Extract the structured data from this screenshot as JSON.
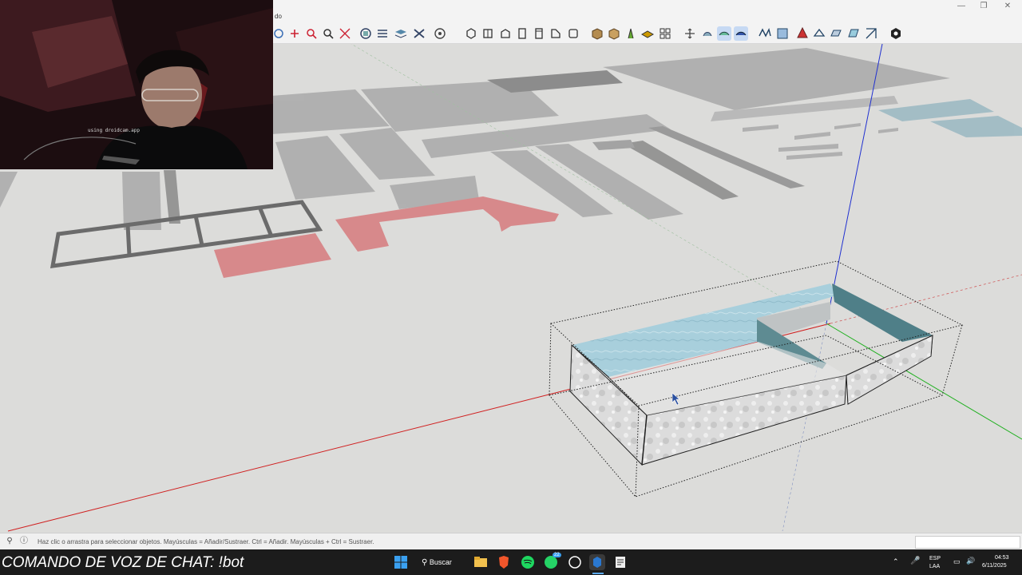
{
  "titlebar": {
    "menu_fragment": "do",
    "minimize_icon": "minimize-icon",
    "maximize_icon": "restore-icon",
    "close_icon": "close-icon"
  },
  "toolbar": {
    "icons": [
      "orbit-icon",
      "pan-icon",
      "zoom-icon",
      "zoom-extents-icon",
      "section-icon",
      "axes-icon",
      "layers-icon",
      "styles-icon",
      "camera-icon",
      "iso-view-icon",
      "top-view-icon",
      "front-view-icon",
      "right-view-icon",
      "back-view-icon",
      "left-view-icon",
      "bottom-view-icon",
      "xray-icon",
      "back-edges-icon",
      "wireframe-icon",
      "hidden-line-icon",
      "shaded-icon",
      "shaded-textures-icon",
      "position-camera-icon",
      "walk-icon",
      "look-around-icon",
      "sandbox-icon",
      "extension-icon",
      "warehouse-icon",
      "extension-manager-icon",
      "send-icon",
      "profile-icon"
    ]
  },
  "statusbar": {
    "text": "Haz clic o arrastra para seleccionar objetos. Mayúsculas = Añadir/Sustraer. Ctrl = Añadir. Mayúsculas + Ctrl = Sustraer.",
    "measurements_value": ""
  },
  "overlay": {
    "chat_command": "COMANDO DE VOZ DE CHAT: !bot"
  },
  "webcam": {
    "caption": "using droidcam.app"
  },
  "taskbar": {
    "search_label": "Buscar",
    "apps": [
      "windows-start-icon",
      "search-icon",
      "file-explorer-icon",
      "brave-icon",
      "spotify-icon",
      "whatsapp-icon",
      "chatgpt-icon",
      "sketchup-icon",
      "notepad-icon"
    ],
    "whatsapp_badge": "22",
    "lang_top": "ESP",
    "lang_bottom": "LAA",
    "time": "04:53",
    "date": "6/11/2025"
  },
  "colors": {
    "accent": "#0067c0",
    "axis_red": "#d02020",
    "axis_green": "#20b020",
    "axis_blue": "#2030d0",
    "water": "#9fc7d6",
    "red_shape": "#d7898b"
  }
}
